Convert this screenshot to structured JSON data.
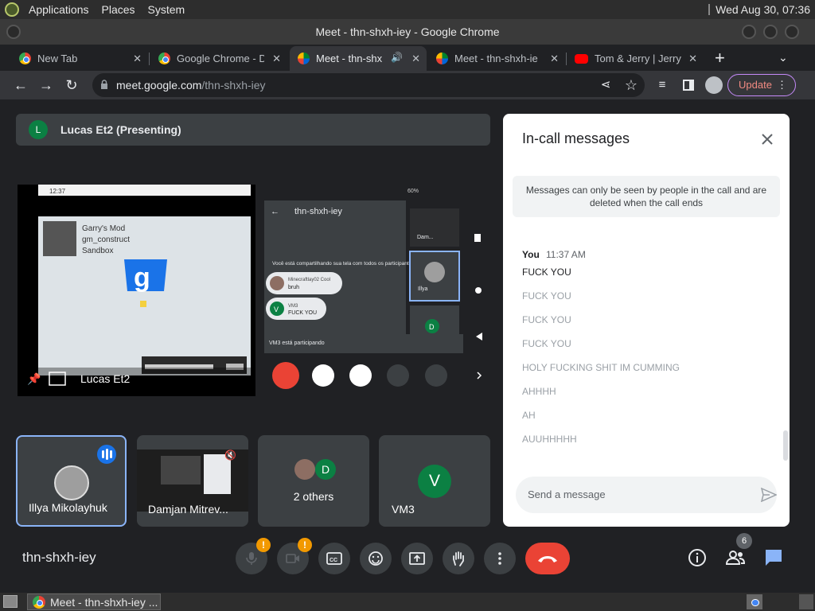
{
  "os": {
    "menus": [
      "Applications",
      "Places",
      "System"
    ],
    "clock": "Wed Aug 30, 07:36"
  },
  "window": {
    "title": "Meet - thn-shxh-iey - Google Chrome"
  },
  "tabs": [
    {
      "label": "New Tab",
      "icon": "chrome-icon"
    },
    {
      "label": "Google Chrome - D",
      "icon": "chrome-icon"
    },
    {
      "label": "Meet - thn-shx",
      "icon": "meet-icon",
      "active": true
    },
    {
      "label": "Meet - thn-shxh-ie",
      "icon": "meet-icon"
    },
    {
      "label": "Tom & Jerry | Jerry",
      "icon": "youtube-icon"
    }
  ],
  "omnibox": {
    "host": "meet.google.com",
    "path": "/thn-shxh-iey"
  },
  "toolbar": {
    "update_label": "Update"
  },
  "meet": {
    "presenter": {
      "initial": "L",
      "label": "Lucas Et2 (Presenting)"
    },
    "stage": {
      "name": "Lucas Et2",
      "screen": {
        "status_time": "12:37",
        "battery": "60%",
        "game_lines": [
          "Garry's Mod",
          "gm_construct",
          "Sandbox"
        ],
        "meeting_code": "thn-shxh-iey",
        "sharing_text": "Você está compartilhando sua tela com todos os participantes.",
        "bubble_1_name": "Minecraftlay02 Cool",
        "bubble_1_text": "bruh",
        "bubble_2_initial": "V",
        "bubble_2_name": "VM3",
        "bubble_2_text": "FUCK YOU",
        "joined_text": "VM3 está participando",
        "side_tile_1": "Dam...",
        "side_tile_2": "Illya",
        "side_tile_3": "D"
      }
    },
    "tiles": [
      {
        "name": "Illya Mikolayhuk"
      },
      {
        "name": "Damjan Mitrev..."
      },
      {
        "name": "2 others",
        "initial": "D"
      },
      {
        "name": "VM3",
        "initial": "V"
      }
    ],
    "meeting_code": "thn-shxh-iey",
    "people_count": "6",
    "warn_glyph": "!"
  },
  "chat": {
    "title": "In-call messages",
    "notice": "Messages can only be seen by people in the call and are deleted when the call ends",
    "sender": "You",
    "time": "11:37 AM",
    "messages": [
      "FUCK YOU",
      "FUCK YOU",
      "FUCK YOU",
      "FUCK YOU",
      "HOLY FUCKING SHIT IM CUMMING",
      "AHHHH",
      "AH",
      "AUUHHHHH"
    ],
    "input_placeholder": "Send a message"
  },
  "taskbar": {
    "item_label": "Meet - thn-shxh-iey ..."
  },
  "colors": {
    "meet_bg": "#202124",
    "tile_bg": "#3c4043",
    "end_call": "#ea4335",
    "warning": "#f29900",
    "active_speaker": "#8ab4f8",
    "presenter_avatar": "#0b8043"
  }
}
